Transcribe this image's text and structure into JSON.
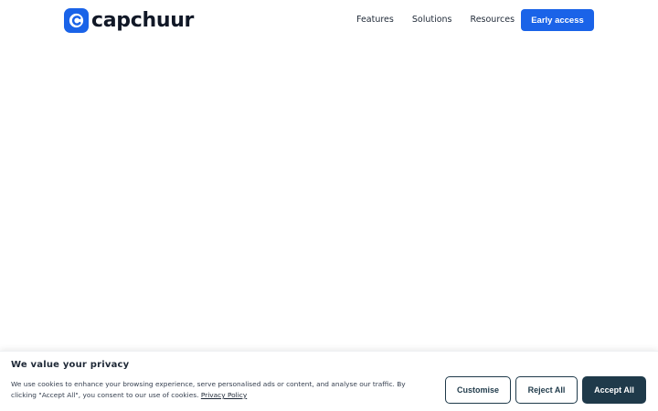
{
  "header": {
    "logo_text": "capchuur",
    "nav": [
      "Features",
      "Solutions",
      "Resources"
    ],
    "cta_label": "Early access"
  },
  "cookie_banner": {
    "title": "We value your privacy",
    "text": "We use cookies to enhance your browsing experience, serve personalised ads or content, and analyse our traffic. By clicking \"Accept All\", you consent to our use of cookies.",
    "privacy_link": "Privacy Policy",
    "buttons": {
      "customise": "Customise",
      "reject": "Reject All",
      "accept": "Accept All"
    }
  },
  "colors": {
    "brand_blue": "#1a63e8",
    "dark_teal": "#1f3a4a"
  }
}
